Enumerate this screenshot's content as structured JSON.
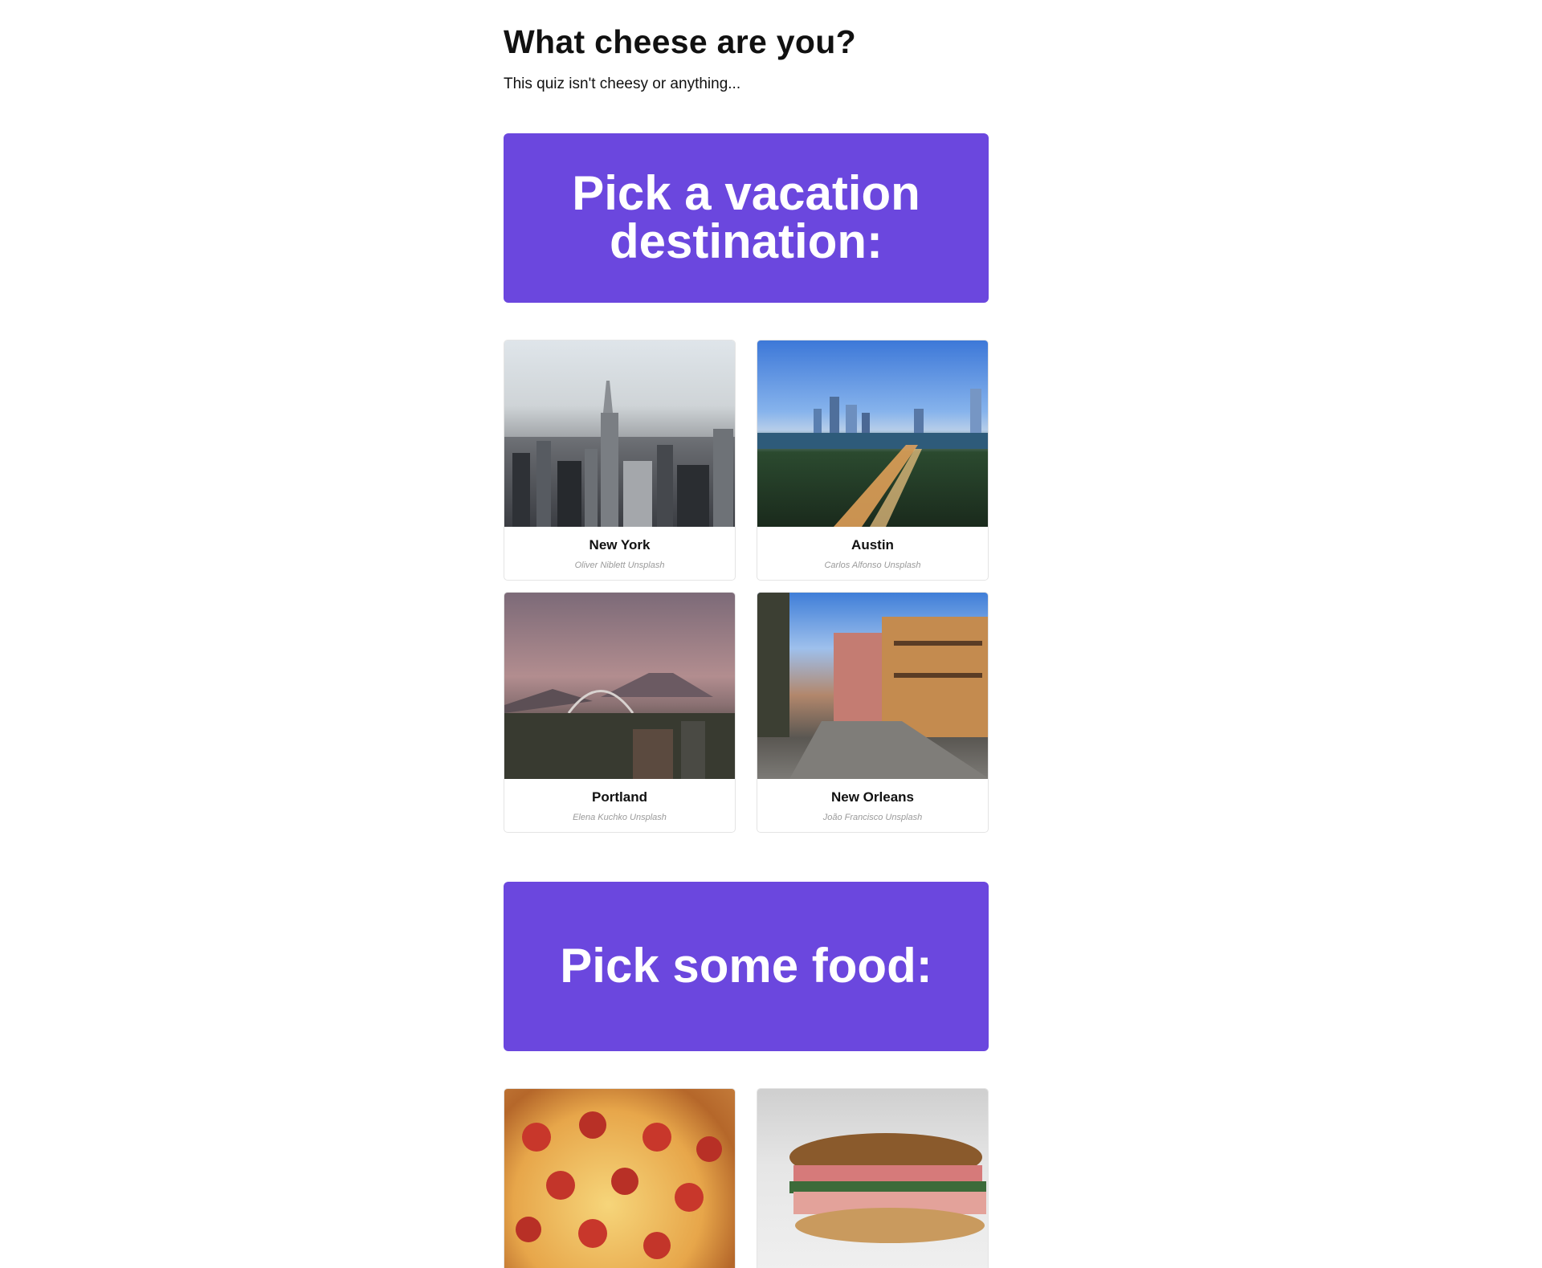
{
  "header": {
    "title": "What cheese are you?",
    "subtitle": "This quiz isn't cheesy or anything..."
  },
  "questions": [
    {
      "prompt": "Pick a vacation destination:",
      "answers": [
        {
          "label": "New York",
          "credit": "Oliver Niblett Unsplash"
        },
        {
          "label": "Austin",
          "credit": "Carlos Alfonso Unsplash"
        },
        {
          "label": "Portland",
          "credit": "Elena Kuchko Unsplash"
        },
        {
          "label": "New Orleans",
          "credit": "João Francisco Unsplash"
        }
      ]
    },
    {
      "prompt": "Pick some food:",
      "answers": [
        {
          "label": "",
          "credit": ""
        },
        {
          "label": "",
          "credit": ""
        }
      ]
    }
  ],
  "colors": {
    "question_banner": "#6b47de",
    "text": "#111111",
    "credit": "#9a9a9a"
  }
}
